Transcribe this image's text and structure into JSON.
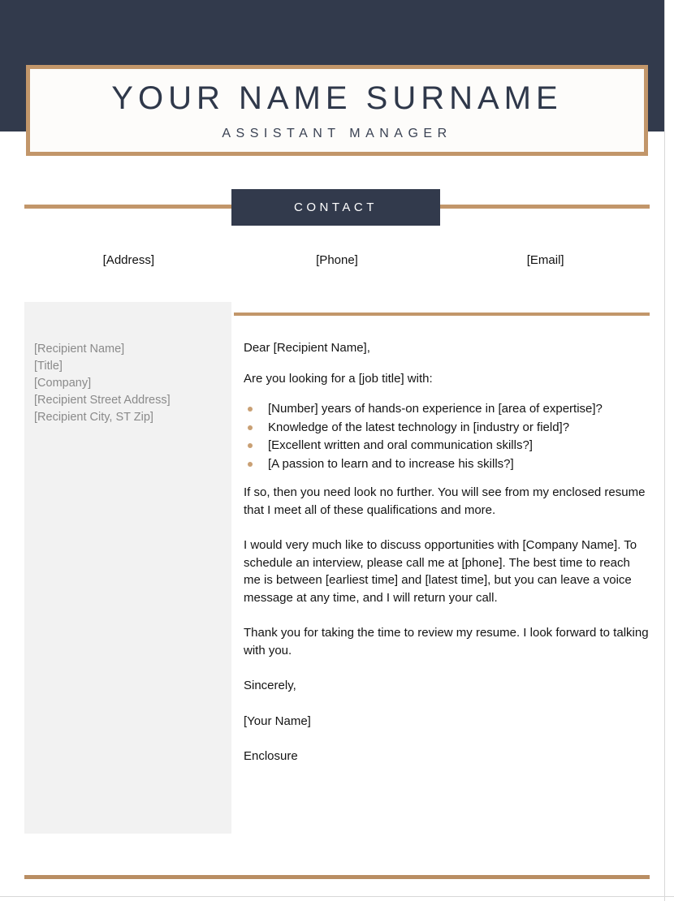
{
  "header": {
    "name": "YOUR NAME SURNAME",
    "job_title": "ASSISTANT MANAGER",
    "band_color": "#323a4c",
    "accent_color": "#c2966a"
  },
  "contact": {
    "banner_label": "CONTACT",
    "fields": [
      {
        "label": "[Address]"
      },
      {
        "label": "[Phone]"
      },
      {
        "label": "[Email]"
      }
    ]
  },
  "recipient": {
    "lines": [
      "[Recipient Name]",
      "[Title]",
      "[Company]",
      "[Recipient Street Address]",
      "[Recipient City, ST Zip]"
    ]
  },
  "letter": {
    "salutation": "Dear [Recipient Name],",
    "intro": "Are you looking for a [job title] with:",
    "qualifications": [
      "[Number] years of hands-on experience in [area of expertise]?",
      "Knowledge of the latest technology in [industry or field]?",
      "[Excellent written and oral communication skills?]",
      "[A passion to learn and to increase his skills?]"
    ],
    "paragraph_1": "If so, then you need look no further. You will see from my enclosed resume that I meet all of these qualifications and more.",
    "paragraph_2": "I would very much like to discuss opportunities with [Company Name]. To schedule an interview, please call me at [phone]. The best time to reach me is between [earliest time] and [latest time], but you can leave a voice message at any time, and I will return your call.",
    "paragraph_3": "Thank you for taking the time to review my resume. I look forward to talking with you.",
    "closing": "Sincerely,",
    "signature_name": "[Your Name]",
    "enclosure": "Enclosure"
  }
}
